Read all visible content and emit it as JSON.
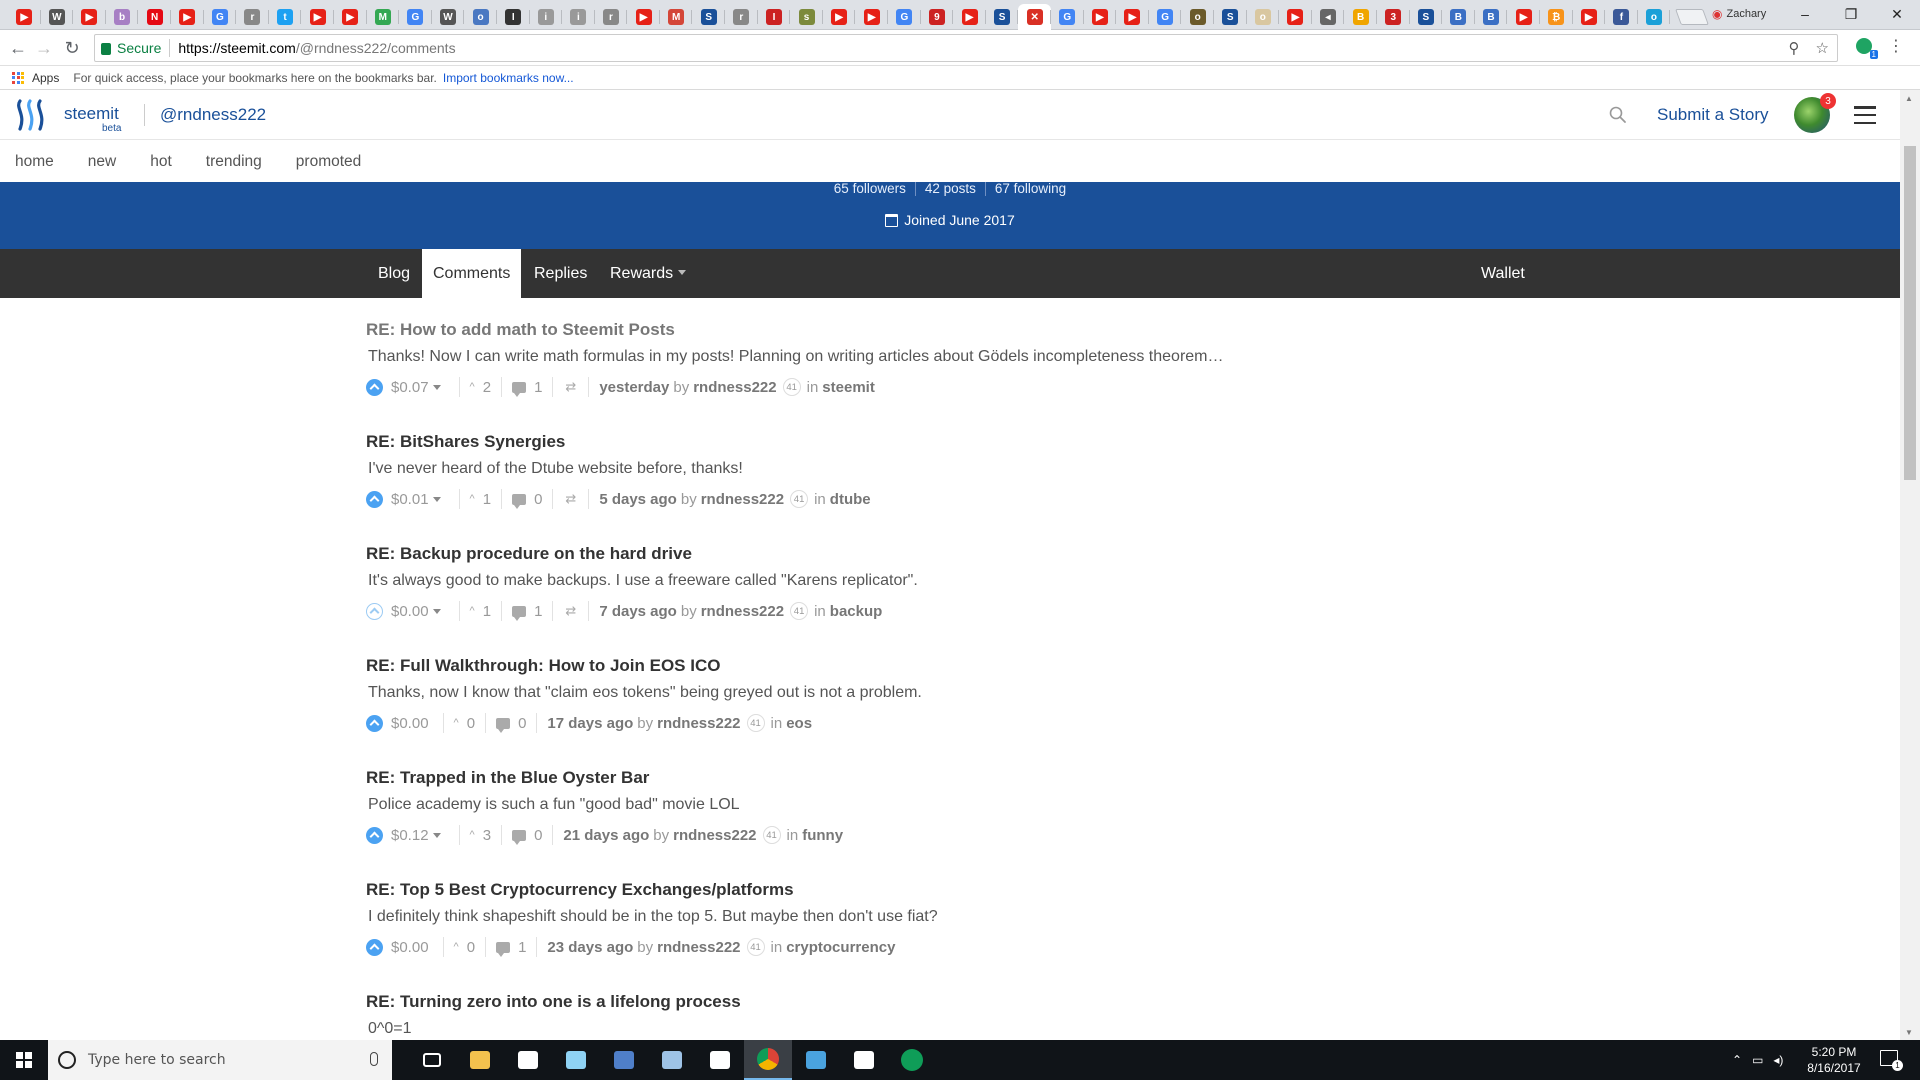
{
  "browser": {
    "tab_favicons": [
      {
        "icon": "youtube-icon",
        "color": "#e62117",
        "glyph": "▶"
      },
      {
        "icon": "wikipedia-icon",
        "color": "#555555",
        "glyph": "W"
      },
      {
        "icon": "youtube-icon",
        "color": "#e62117",
        "glyph": "▶"
      },
      {
        "icon": "generic-icon",
        "color": "#a77fc4",
        "glyph": "b"
      },
      {
        "icon": "netflix-icon",
        "color": "#e50914",
        "glyph": "N"
      },
      {
        "icon": "youtube-icon",
        "color": "#e62117",
        "glyph": "▶"
      },
      {
        "icon": "google-icon",
        "color": "#4285f4",
        "glyph": "G"
      },
      {
        "icon": "reddit-icon",
        "color": "#888888",
        "glyph": "r"
      },
      {
        "icon": "twitter-icon",
        "color": "#1da1f2",
        "glyph": "t"
      },
      {
        "icon": "youtube-icon",
        "color": "#e62117",
        "glyph": "▶"
      },
      {
        "icon": "youtube-icon",
        "color": "#e62117",
        "glyph": "▶"
      },
      {
        "icon": "maps-icon",
        "color": "#34a853",
        "glyph": "M"
      },
      {
        "icon": "google-icon",
        "color": "#4285f4",
        "glyph": "G"
      },
      {
        "icon": "wikipedia-icon",
        "color": "#555555",
        "glyph": "W"
      },
      {
        "icon": "generic-icon",
        "color": "#4a78c2",
        "glyph": "o"
      },
      {
        "icon": "generic-icon",
        "color": "#333333",
        "glyph": "I"
      },
      {
        "icon": "generic-icon",
        "color": "#999999",
        "glyph": "i"
      },
      {
        "icon": "generic-icon",
        "color": "#999999",
        "glyph": "i"
      },
      {
        "icon": "reddit-icon",
        "color": "#888888",
        "glyph": "r"
      },
      {
        "icon": "youtube-icon",
        "color": "#e62117",
        "glyph": "▶"
      },
      {
        "icon": "gmail-icon",
        "color": "#d44638",
        "glyph": "M"
      },
      {
        "icon": "steemit-icon",
        "color": "#1a5099",
        "glyph": "S"
      },
      {
        "icon": "reddit-icon",
        "color": "#888888",
        "glyph": "r"
      },
      {
        "icon": "generic-icon",
        "color": "#cc2222",
        "glyph": "I"
      },
      {
        "icon": "generic-icon",
        "color": "#7c8a3c",
        "glyph": "s"
      },
      {
        "icon": "youtube-icon",
        "color": "#e62117",
        "glyph": "▶"
      },
      {
        "icon": "youtube-icon",
        "color": "#e62117",
        "glyph": "▶"
      },
      {
        "icon": "google-icon",
        "color": "#4285f4",
        "glyph": "G"
      },
      {
        "icon": "generic-icon",
        "color": "#cc2222",
        "glyph": "9"
      },
      {
        "icon": "youtube-icon",
        "color": "#e62117",
        "glyph": "▶"
      },
      {
        "icon": "steemit-icon",
        "color": "#1a5099",
        "glyph": "S"
      },
      {
        "icon": "close-tab-icon",
        "color": "#d93025",
        "glyph": "✕"
      },
      {
        "icon": "google-icon",
        "color": "#4285f4",
        "glyph": "G"
      },
      {
        "icon": "youtube-icon",
        "color": "#e62117",
        "glyph": "▶"
      },
      {
        "icon": "youtube-icon",
        "color": "#e62117",
        "glyph": "▶"
      },
      {
        "icon": "google-icon",
        "color": "#4285f4",
        "glyph": "G"
      },
      {
        "icon": "generic-icon",
        "color": "#6b5a2a",
        "glyph": "o"
      },
      {
        "icon": "steemit-icon",
        "color": "#1a5099",
        "glyph": "S"
      },
      {
        "icon": "generic-icon",
        "color": "#d9c7a0",
        "glyph": "o"
      },
      {
        "icon": "youtube-icon",
        "color": "#e62117",
        "glyph": "▶"
      },
      {
        "icon": "speaker-icon",
        "color": "#666666",
        "glyph": "◂"
      },
      {
        "icon": "generic-icon",
        "color": "#f0a500",
        "glyph": "B"
      },
      {
        "icon": "generic-icon",
        "color": "#cc2222",
        "glyph": "3"
      },
      {
        "icon": "steemit-icon",
        "color": "#1a5099",
        "glyph": "S"
      },
      {
        "icon": "generic-icon",
        "color": "#3b6fc4",
        "glyph": "B"
      },
      {
        "icon": "generic-icon",
        "color": "#3b6fc4",
        "glyph": "B"
      },
      {
        "icon": "youtube-icon",
        "color": "#e62117",
        "glyph": "▶"
      },
      {
        "icon": "bitcoin-icon",
        "color": "#f7931a",
        "glyph": "₿"
      },
      {
        "icon": "youtube-icon",
        "color": "#e62117",
        "glyph": "▶"
      },
      {
        "icon": "facebook-icon",
        "color": "#3b5998",
        "glyph": "f"
      },
      {
        "icon": "generic-icon",
        "color": "#1ba0d8",
        "glyph": "o"
      }
    ],
    "active_tab_index": 31,
    "profile_name": "Zachary",
    "window_controls": {
      "minimize": "–",
      "restore": "❐",
      "close": "✕"
    },
    "address": {
      "secure_label": "Secure",
      "url_scheme_host": "https://steemit.com",
      "url_path": "/@rndness222/comments"
    },
    "bookmarks": {
      "apps_label": "Apps",
      "hint": "For quick access, place your bookmarks here on the bookmarks bar.",
      "import_link": "Import bookmarks now..."
    }
  },
  "site": {
    "brand": "steemit",
    "beta": "beta",
    "username": "@rndness222",
    "submit": "Submit a Story",
    "notification_count": "3",
    "brand_color": "#1a5099",
    "nav": [
      "home",
      "new",
      "hot",
      "trending",
      "promoted"
    ]
  },
  "profile": {
    "followers": "65 followers",
    "posts": "42 posts",
    "following": "67 following",
    "joined": "Joined June 2017",
    "tabs": {
      "blog": "Blog",
      "comments": "Comments",
      "replies": "Replies",
      "rewards": "Rewards",
      "wallet": "Wallet"
    }
  },
  "comments": [
    {
      "title": "RE: How to add math to Steemit Posts",
      "body": "Thanks! Now I can write math formulas in my posts! Planning on writing articles about Gödels incompleteness theorem…",
      "payout": "$0.07",
      "has_dropdown": true,
      "voted": true,
      "votes": "2",
      "replies": "1",
      "has_reblog": true,
      "time": "yesterday",
      "by": "by",
      "author": "rndness222",
      "rep": "41",
      "in": "in",
      "category": "steemit"
    },
    {
      "title": "RE: BitShares Synergies",
      "body": "I've never heard of the Dtube website before, thanks!",
      "payout": "$0.01",
      "has_dropdown": true,
      "voted": true,
      "votes": "1",
      "replies": "0",
      "has_reblog": true,
      "time": "5 days ago",
      "by": "by",
      "author": "rndness222",
      "rep": "41",
      "in": "in",
      "category": "dtube"
    },
    {
      "title": "RE: Backup procedure on the hard drive",
      "body": "It's always good to make backups. I use a freeware called \"Karens replicator\".",
      "payout": "$0.00",
      "has_dropdown": true,
      "voted": false,
      "votes": "1",
      "replies": "1",
      "has_reblog": true,
      "time": "7 days ago",
      "by": "by",
      "author": "rndness222",
      "rep": "41",
      "in": "in",
      "category": "backup"
    },
    {
      "title": "RE: Full Walkthrough: How to Join EOS ICO",
      "body": "Thanks, now I know that \"claim eos tokens\" being greyed out is not a problem.",
      "payout": "$0.00",
      "has_dropdown": false,
      "voted": true,
      "votes": "0",
      "replies": "0",
      "has_reblog": false,
      "time": "17 days ago",
      "by": "by",
      "author": "rndness222",
      "rep": "41",
      "in": "in",
      "category": "eos"
    },
    {
      "title": "RE: Trapped in the Blue Oyster Bar",
      "body": "Police academy is such a fun \"good bad\" movie LOL",
      "payout": "$0.12",
      "has_dropdown": true,
      "voted": true,
      "votes": "3",
      "replies": "0",
      "has_reblog": false,
      "time": "21 days ago",
      "by": "by",
      "author": "rndness222",
      "rep": "41",
      "in": "in",
      "category": "funny"
    },
    {
      "title": "RE: Top 5 Best Cryptocurrency Exchanges/platforms",
      "body": "I definitely think shapeshift should be in the top 5. But maybe then don't use fiat?",
      "payout": "$0.00",
      "has_dropdown": false,
      "voted": true,
      "votes": "0",
      "replies": "1",
      "has_reblog": false,
      "time": "23 days ago",
      "by": "by",
      "author": "rndness222",
      "rep": "41",
      "in": "in",
      "category": "cryptocurrency"
    },
    {
      "title": "RE: Turning zero into one is a lifelong process",
      "body": "0^0=1",
      "partial": true
    }
  ],
  "taskbar": {
    "search_placeholder": "Type here to search",
    "apps": [
      {
        "name": "task-view",
        "color": "#ffffff"
      },
      {
        "name": "file-explorer",
        "color": "#f2c14e"
      },
      {
        "name": "mail",
        "color": "#ffffff"
      },
      {
        "name": "notes",
        "color": "#8fd3f4"
      },
      {
        "name": "monitor-app",
        "color": "#4f7fc9"
      },
      {
        "name": "paint-app",
        "color": "#9ec3e6"
      },
      {
        "name": "store",
        "color": "#ffffff"
      },
      {
        "name": "chrome",
        "color": "#dd4b39"
      },
      {
        "name": "tool-app",
        "color": "#4aa3df"
      },
      {
        "name": "calculator",
        "color": "#ffffff"
      },
      {
        "name": "hangouts",
        "color": "#0f9d58"
      }
    ],
    "active_app": "chrome",
    "time": "5:20 PM",
    "date": "8/16/2017",
    "notifications": "1"
  }
}
